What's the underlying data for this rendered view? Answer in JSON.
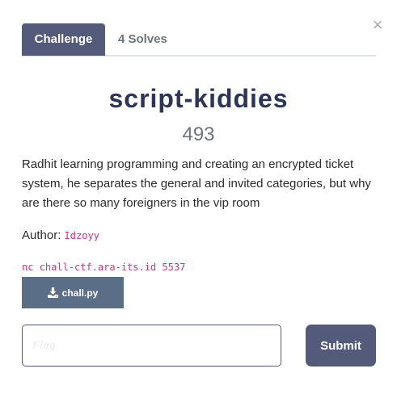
{
  "modal": {
    "close_symbol": "×",
    "close_icon": "close-icon"
  },
  "tabs": {
    "challenge_label": "Challenge",
    "solves_label": "4 Solves"
  },
  "challenge": {
    "name": "script-kiddies",
    "value": "493",
    "description": "Radhit learning programming and creating an encrypted ticket system, he separates the general and invited categories, but why are there so many foreigners in the vip room",
    "author_label": "Author:",
    "author_name": "Idzoyy",
    "connection": "nc chall-ctf.ara-its.id 5537",
    "file_name": "chall.py",
    "file_icon": "download-icon"
  },
  "form": {
    "flag_placeholder": "Flag",
    "submit_label": "Submit"
  },
  "colors": {
    "primary": "#545b7a",
    "title": "#2c3557",
    "code": "#d63384",
    "file_button": "#5b6e87"
  }
}
